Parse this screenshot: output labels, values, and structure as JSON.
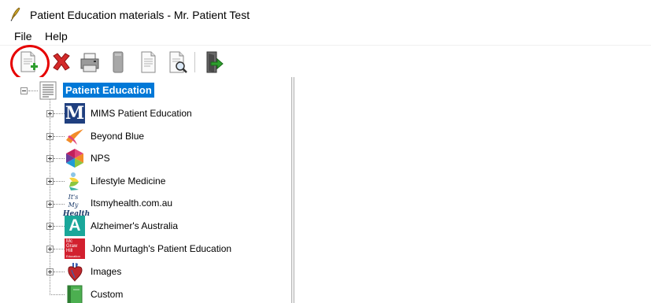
{
  "window": {
    "title": "Patient Education materials - Mr. Patient Test"
  },
  "menu": {
    "items": [
      {
        "label": "File"
      },
      {
        "label": "Help"
      }
    ]
  },
  "toolbar": {
    "buttons": [
      {
        "icon": "new-document-icon",
        "highlighted": true
      },
      {
        "icon": "delete-icon"
      },
      {
        "icon": "print-icon"
      },
      {
        "icon": "blank-icon"
      },
      {
        "icon": "document-icon"
      },
      {
        "icon": "print-preview-icon"
      },
      {
        "icon": "exit-icon"
      }
    ],
    "highlight_color": "#e60000"
  },
  "tree": {
    "root": {
      "label": "Patient Education",
      "selected": true,
      "expanded": true
    },
    "children": [
      {
        "label": "MIMS Patient Education",
        "icon": "mims-logo-icon",
        "icon_text": "M",
        "expandable": true
      },
      {
        "label": "Beyond Blue",
        "icon": "beyond-blue-logo-icon",
        "expandable": true
      },
      {
        "label": "NPS",
        "icon": "nps-logo-icon",
        "expandable": true
      },
      {
        "label": "Lifestyle Medicine",
        "icon": "lifestyle-medicine-logo-icon",
        "expandable": true
      },
      {
        "label": "Itsmyhealth.com.au",
        "icon": "itsmyhealth-logo-icon",
        "icon_text_top": "It's My",
        "icon_text_bottom": "Health",
        "expandable": true
      },
      {
        "label": "Alzheimer's Australia",
        "icon": "alzheimers-logo-icon",
        "icon_text": "A",
        "expandable": true
      },
      {
        "label": "John Murtagh's Patient Education",
        "icon": "mcgraw-hill-logo-icon",
        "icon_lines": [
          "Mc",
          "Graw",
          "Hill",
          "Education"
        ],
        "expandable": true
      },
      {
        "label": "Images",
        "icon": "anatomy-heart-icon",
        "expandable": true
      },
      {
        "label": "Custom",
        "icon": "green-book-icon",
        "expandable": false
      }
    ]
  },
  "colors": {
    "selection": "#0078d7",
    "mims_blue": "#1f3f7f",
    "alzheimers_teal": "#1aa79a",
    "mcgraw_red": "#d2202f",
    "custom_green": "#4caf50"
  }
}
